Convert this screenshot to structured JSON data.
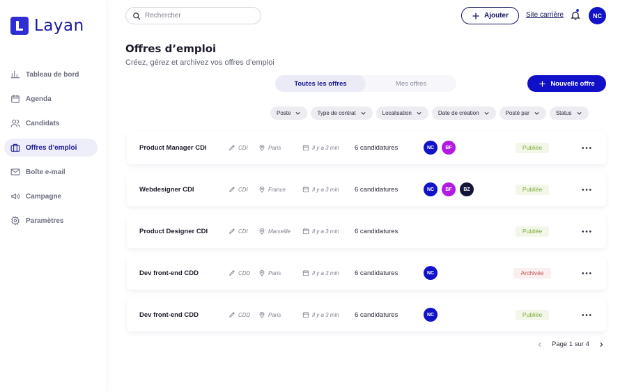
{
  "brand": {
    "name": "Layan",
    "color": "#2e2ed3"
  },
  "sidebar": {
    "items": [
      {
        "label": "Tableau de bord",
        "icon": "chart-bars-icon",
        "active": false
      },
      {
        "label": "Agenda",
        "icon": "calendar-icon",
        "active": false
      },
      {
        "label": "Candidats",
        "icon": "users-icon",
        "active": false
      },
      {
        "label": "Offres d’emploi",
        "icon": "briefcase-icon",
        "active": true
      },
      {
        "label": "Boîte e-mail",
        "icon": "mail-icon",
        "active": false
      },
      {
        "label": "Campagne",
        "icon": "megaphone-icon",
        "active": false
      },
      {
        "label": "Paramètres",
        "icon": "gear-icon",
        "active": false
      }
    ]
  },
  "topbar": {
    "search_placeholder": "Rechercher",
    "add_label": "Ajouter",
    "site_link": "Site carrière",
    "user_initials": "NC"
  },
  "page": {
    "title": "Offres d’emploi",
    "subtitle": "Créez, gérez et archivez vos offres d’emploi"
  },
  "tabs": [
    {
      "label": "Toutes les offres",
      "active": true
    },
    {
      "label": "Mes offres",
      "active": false
    }
  ],
  "new_offer_label": "Nouvelle offre",
  "filters": [
    "Poste",
    "Type de contrat",
    "Localisation",
    "Date de création",
    "Posté par",
    "Status"
  ],
  "offers": [
    {
      "title": "Product Manager CDI",
      "contract": "CDI",
      "location": "Paris",
      "date": "Il y a 3 min",
      "candidates": "6 candidatures",
      "avatars": [
        {
          "initials": "NC",
          "color": "#1212c8"
        },
        {
          "initials": "BF",
          "color": "#b21be0"
        }
      ],
      "status": "Publiée",
      "status_type": "published"
    },
    {
      "title": "Webdesigner CDI",
      "contract": "CDI",
      "location": "France",
      "date": "Il y a 3 min",
      "candidates": "6 candidatures",
      "avatars": [
        {
          "initials": "NC",
          "color": "#1212c8"
        },
        {
          "initials": "BF",
          "color": "#b21be0"
        },
        {
          "initials": "BZ",
          "color": "#14143a"
        }
      ],
      "status": "Publiée",
      "status_type": "published"
    },
    {
      "title": "Product Designer CDI",
      "contract": "CDI",
      "location": "Marseille",
      "date": "Il y a 3 min",
      "candidates": "6 candidatures",
      "avatars": [],
      "status": "Publiée",
      "status_type": "published"
    },
    {
      "title": "Dev front-end CDD",
      "contract": "CDD",
      "location": "Paris",
      "date": "Il y a 3 min",
      "candidates": "6 candidatures",
      "avatars": [
        {
          "initials": "NC",
          "color": "#1212c8"
        }
      ],
      "status": "Archivée",
      "status_type": "archived"
    },
    {
      "title": "Dev front-end CDD",
      "contract": "CDD",
      "location": "Paris",
      "date": "Il y a 3 min",
      "candidates": "6 candidatures",
      "avatars": [
        {
          "initials": "NC",
          "color": "#1212c8"
        }
      ],
      "status": "Publiée",
      "status_type": "published"
    }
  ],
  "status_colors": {
    "published": {
      "bg": "#f2f7e9",
      "fg": "#7faa3a"
    },
    "archived": {
      "bg": "#fbeeee",
      "fg": "#c45050"
    }
  },
  "pagination": {
    "label": "Page 1 sur 4"
  }
}
